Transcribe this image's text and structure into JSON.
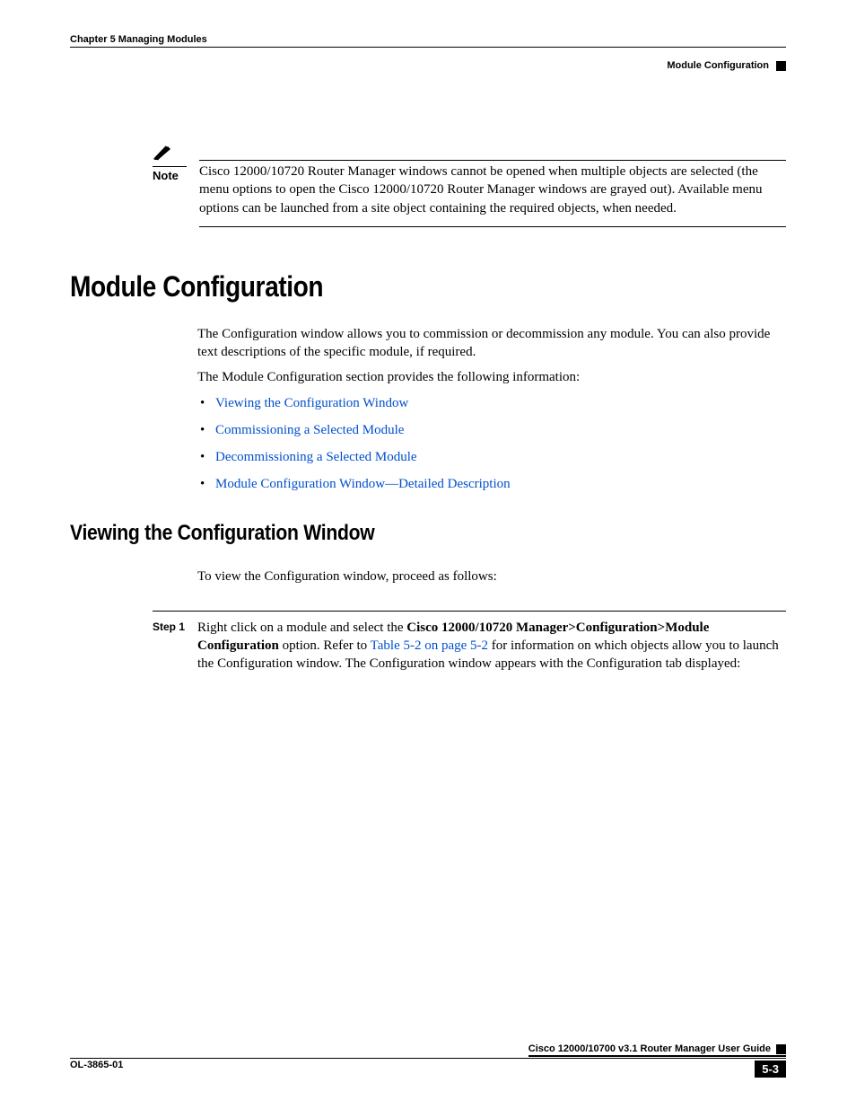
{
  "header": {
    "chapter": "Chapter 5      Managing Modules",
    "section": "Module Configuration"
  },
  "note": {
    "label": "Note",
    "text": "Cisco 12000/10720 Router Manager windows cannot be opened when multiple objects are selected (the menu options to open the Cisco 12000/10720 Router Manager windows are grayed out). Available menu options can be launched from a site object containing the required objects, when needed."
  },
  "heading1": "Module Configuration",
  "intro1": "The Configuration window allows you to commission or decommission any module. You can also provide text descriptions of the specific module, if required.",
  "intro2": "The Module Configuration section provides the following information:",
  "bullets": [
    "Viewing the Configuration Window",
    "Commissioning a Selected Module",
    "Decommissioning a Selected Module",
    "Module Configuration Window—Detailed Description"
  ],
  "heading2": "Viewing the Configuration Window",
  "intro3": "To view the Configuration window, proceed as follows:",
  "step1": {
    "label": "Step 1",
    "pre": "Right click on a module and select the ",
    "bold": "Cisco 12000/10720 Manager>Configuration>Module Configuration",
    "mid": " option. Refer to ",
    "link": "Table 5-2 on page 5-2",
    "post": " for information on which objects allow you to launch the Configuration window. The Configuration window appears with the Configuration tab displayed:"
  },
  "footer": {
    "guide": "Cisco 12000/10700 v3.1 Router Manager User Guide",
    "ol": "OL-3865-01",
    "page": "5-3"
  }
}
